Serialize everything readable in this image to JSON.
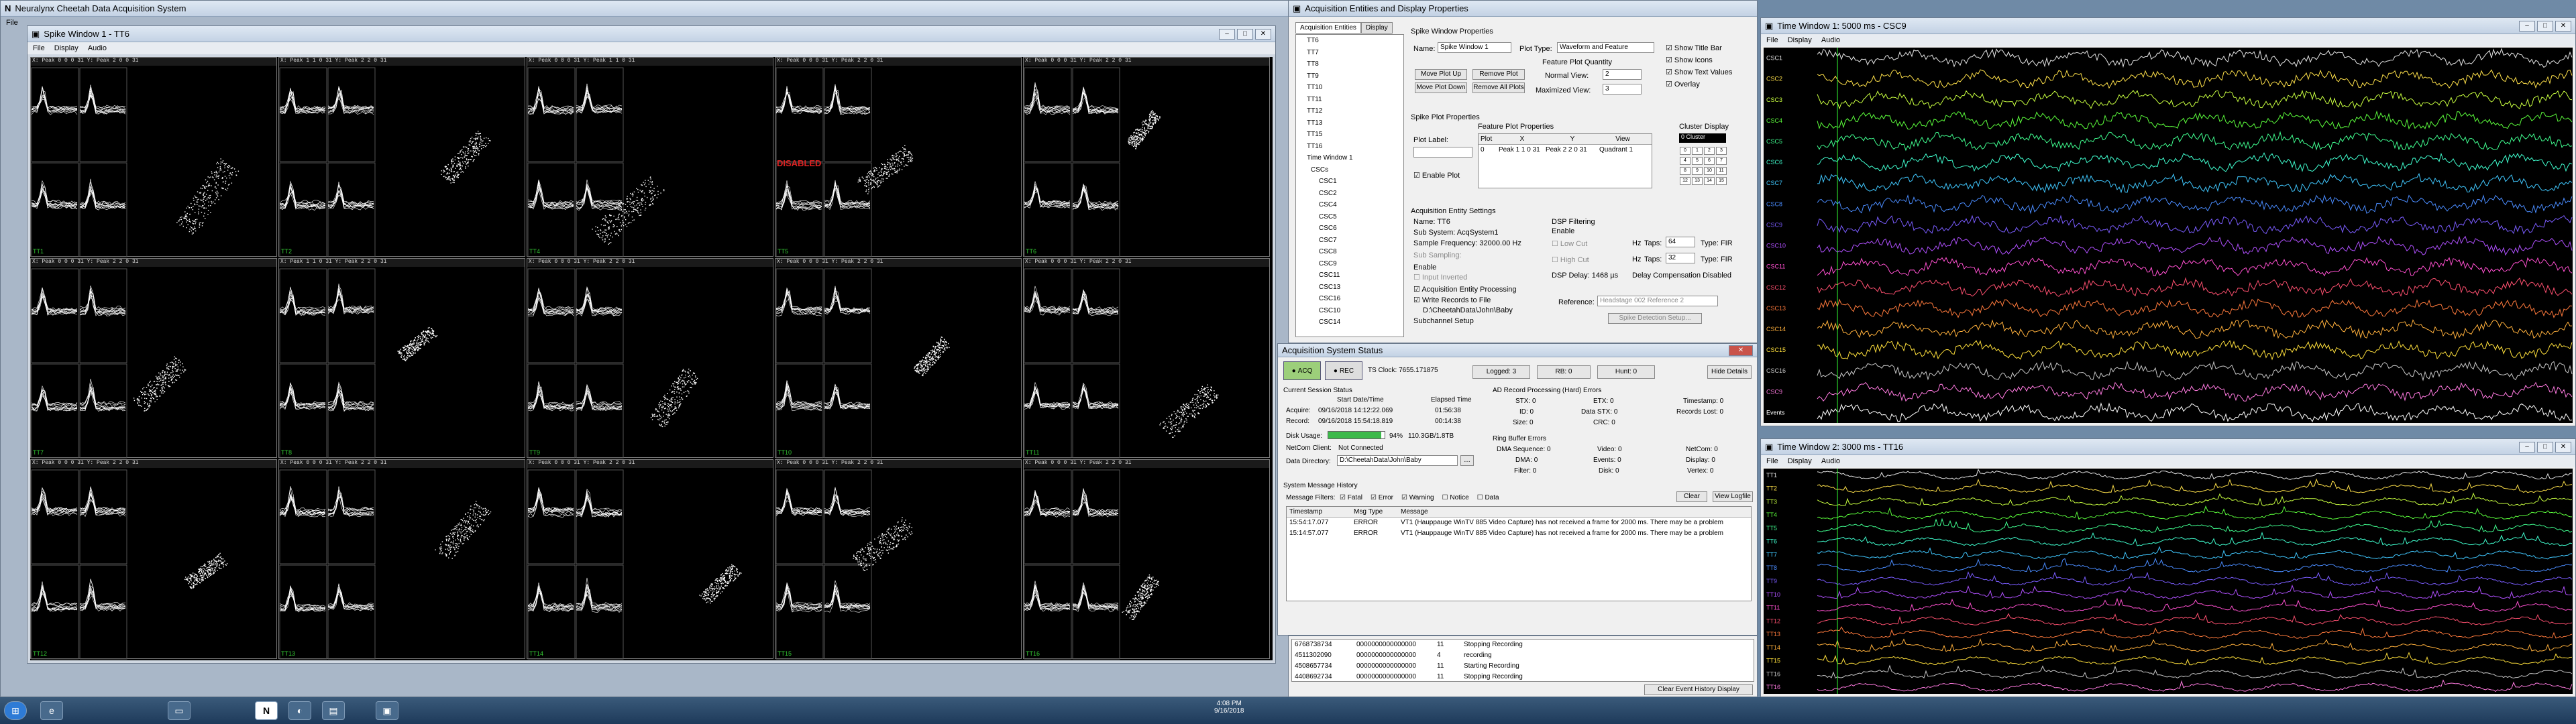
{
  "app_title": "Neuralynx Cheetah Data Acquisition System",
  "app_menu": [
    "File"
  ],
  "spike_window": {
    "title": "Spike Window 1 - TT6",
    "menu": [
      "File",
      "Display",
      "Audio"
    ],
    "cells": [
      {
        "name": "TT1",
        "peak_x": "X: Peak 0 0 0 31",
        "peak_y": "Y: Peak 2 0 0 31"
      },
      {
        "name": "TT2",
        "peak_x": "X: Peak 1 1 0 31",
        "peak_y": "Y: Peak 2 2 0 31"
      },
      {
        "name": "TT4",
        "peak_x": "X: Peak 0 0 0 31",
        "peak_y": "Y: Peak 1 1 0 31"
      },
      {
        "name": "TT5",
        "peak_x": "X: Peak 0 0 0 31",
        "peak_y": "Y: Peak 2 2 0 31"
      },
      {
        "name": "TT6",
        "peak_x": "X: Peak 0 0 0 31",
        "peak_y": "Y: Peak 2 2 0 31"
      },
      {
        "name": "TT7",
        "peak_x": "X: Peak 0 0 0 31",
        "peak_y": "Y: Peak 2 2 0 31"
      },
      {
        "name": "TT8",
        "peak_x": "X: Peak 1 1 0 31",
        "peak_y": "Y: Peak 2 2 0 31"
      },
      {
        "name": "TT9",
        "peak_x": "X: Peak 0 0 0 31",
        "peak_y": "Y: Peak 2 2 0 31"
      },
      {
        "name": "TT10",
        "peak_x": "X: Peak 0 0 0 31",
        "peak_y": "Y: Peak 2 2 0 31"
      },
      {
        "name": "TT11",
        "peak_x": "X: Peak 0 0 0 31",
        "peak_y": "Y: Peak 2 2 0 31"
      },
      {
        "name": "TT12",
        "peak_x": "X: Peak 0 0 0 31",
        "peak_y": "Y: Peak 2 2 0 31"
      },
      {
        "name": "TT13",
        "peak_x": "X: Peak 0 0 0 31",
        "peak_y": "Y: Peak 2 2 0 31"
      },
      {
        "name": "TT14",
        "peak_x": "X: Peak 0 0 0 31",
        "peak_y": "Y: Peak 2 2 0 31"
      },
      {
        "name": "TT15",
        "peak_x": "X: Peak 0 0 0 31",
        "peak_y": "Y: Peak 2 2 0 31"
      },
      {
        "name": "TT16",
        "peak_x": "X: Peak 0 0 0 31",
        "peak_y": "Y: Peak 2 2 0 31"
      }
    ],
    "disabled_label": "DISABLED"
  },
  "props": {
    "title": "Acquisition Entities and Display Properties",
    "tabs": [
      "Acquisition Entities",
      "Display"
    ],
    "tree": [
      "TT6",
      "TT7",
      "TT8",
      "TT9",
      "TT10",
      "TT11",
      "TT12",
      "TT13",
      "TT15",
      "TT16",
      "Time Window 1",
      "CSCs",
      "CSC1",
      "CSC2",
      "CSC4",
      "CSC5",
      "CSC6",
      "CSC7",
      "CSC8",
      "CSC9",
      "CSC11",
      "CSC13",
      "CSC16",
      "CSC10",
      "CSC14"
    ],
    "section_spike": "Spike Window Properties",
    "name_label": "Name:",
    "name_value": "Spike Window 1",
    "plot_type_label": "Plot Type:",
    "plot_type_value": "Waveform and Feature",
    "feature_qty": "Feature Plot Quantity",
    "normal_view_label": "Normal View:",
    "normal_view_value": "2",
    "max_view_label": "Maximized View:",
    "max_view_value": "3",
    "btn_move_up": "Move Plot Up",
    "btn_remove": "Remove Plot",
    "btn_move_down": "Move Plot Down",
    "btn_remove_all": "Remove All Plots",
    "checks": [
      "Show Title Bar",
      "Show Icons",
      "Show Text Values",
      "Overlay"
    ],
    "section_plot": "Spike Plot Properties",
    "feature_props": "Feature Plot Properties",
    "plot_label": "Plot Label:",
    "enable_plot": "Enable Plot",
    "feature_cols": [
      "Plot",
      "X",
      "Y",
      "View"
    ],
    "feature_row": [
      "0",
      "Peak 1 1 0 31",
      "Peak 2 2 0 31",
      "Quadrant 1"
    ],
    "cluster_display": "Cluster Display",
    "cluster_value": "0 Cluster",
    "acq_settings": "Acquisition Entity Settings",
    "acq_name": "Name:  TT6",
    "sub_system": "Sub System:  AcqSystem1",
    "sample_freq": "Sample Frequency:  32000.00 Hz",
    "sub_sampling": "Sub Sampling:",
    "enable": "Enable",
    "input_inverted": "Input Inverted",
    "acq_processing": "Acquisition Entity Processing",
    "write_records": "Write Records to File",
    "data_path": "D:\\CheetahData\\John\\Baby",
    "subchannel": "Subchannel Setup",
    "dsp_filtering": "DSP Filtering",
    "low_cut": "Low Cut",
    "high_cut": "High Cut",
    "hz_label": "Hz",
    "taps_label": "Taps:",
    "taps_low": "64",
    "taps_high": "32",
    "type_fir": "Type: FIR",
    "dsp_delay": "DSP Delay:  1468 µs",
    "delay_comp": "Delay Compensation Disabled",
    "reference_label": "Reference:",
    "reference_value": "Headstage 002 Reference 2",
    "spike_detection": "Spike Detection Setup..."
  },
  "status": {
    "title": "Acquisition System Status",
    "acq": "ACQ",
    "rec": "REC",
    "ts_clock": "TS Clock:  7655.171875",
    "logged": "Logged: 3",
    "rb": "RB: 0",
    "hunt": "Hunt: 0",
    "hide_details": "Hide Details",
    "session_title": "Current Session Status",
    "start_dt": "Start Date/Time",
    "elapsed": "Elapsed Time",
    "acquire_label": "Acquire:",
    "acquire_dt": "09/16/2018 14:12:22.069",
    "acquire_el": "01:56:38",
    "record_label": "Record:",
    "record_dt": "09/16/2018 15:54:18.819",
    "record_el": "00:14:38",
    "disk_label": "Disk Usage:",
    "disk_pct": "94%",
    "disk_pct_value": 0.94,
    "disk_size": "110.3GB/1.8TB",
    "netcom_label": "NetCom Client:",
    "netcom_value": "Not Connected",
    "datadir_label": "Data Directory:",
    "datadir_value": "D:\\CheetahData\\John\\Baby",
    "ad_errors": "AD Record Processing (Hard) Errors",
    "stx": "STX:  0",
    "etx": "ETX:  0",
    "timestamp": "Timestamp:  0",
    "id": "ID:  0",
    "data_stx": "Data STX:  0",
    "records_lost": "Records Lost:  0",
    "size": "Size:  0",
    "crc": "CRC:  0",
    "ring_errors": "Ring Buffer Errors",
    "dma_seq": "DMA Sequence:  0",
    "video": "Video:  0",
    "netcom": "NetCom:  0",
    "dma": "DMA:  0",
    "events": "Events:  0",
    "display": "Display:  0",
    "filter": "Filter:  0",
    "disk": "Disk:  0",
    "vertex": "Vertex:  0",
    "history_title": "System Message History",
    "filters_label": "Message Filters:",
    "filters": [
      "Fatal",
      "Error",
      "Warning",
      "Notice",
      "Data"
    ],
    "clear": "Clear",
    "view_logfile": "View Logfile",
    "msg_cols": [
      "Timestamp",
      "Msg Type",
      "Message"
    ],
    "messages": [
      [
        "15:54:17.077",
        "ERROR",
        "VT1 (Hauppauge WinTV 885 Video Capture) has not received a frame for 2000 ms. There may be a problem"
      ],
      [
        "15:14:57.077",
        "ERROR",
        "VT1 (Hauppauge WinTV 885 Video Capture) has not received a frame for 2000 ms. There may be a problem"
      ]
    ]
  },
  "events": {
    "rows": [
      [
        "6768738734",
        "0000000000000000",
        "11",
        "Stopping Recording"
      ],
      [
        "4511302090",
        "0000000000000000",
        "4",
        "recording"
      ],
      [
        "4508657734",
        "0000000000000000",
        "11",
        "Starting Recording"
      ],
      [
        "4408692734",
        "0000000000000000",
        "11",
        "Stopping Recording"
      ]
    ],
    "clear_btn": "Clear Event History Display"
  },
  "time1": {
    "title": "Time Window 1: 5000 ms - CSC9",
    "menu": [
      "File",
      "Display",
      "Audio"
    ],
    "channels": [
      "CSC1",
      "CSC2",
      "CSC3",
      "CSC4",
      "CSC5",
      "CSC6",
      "CSC7",
      "CSC8",
      "CSC9",
      "CSC10",
      "CSC11",
      "CSC12",
      "CSC13",
      "CSC14",
      "CSC15",
      "CSC16",
      "CSC9",
      "Events"
    ]
  },
  "time2": {
    "title": "Time Window 2: 3000 ms - TT16",
    "menu": [
      "File",
      "Display",
      "Audio"
    ],
    "channels": [
      "TT1",
      "TT2",
      "TT3",
      "TT4",
      "TT5",
      "TT6",
      "TT7",
      "TT8",
      "TT9",
      "TT10",
      "TT11",
      "TT12",
      "TT13",
      "TT14",
      "TT15",
      "TT16",
      "TT16"
    ]
  },
  "taskbar": {
    "time": "4:08 PM",
    "date": "9/16/2018"
  },
  "colors": {
    "csc_palette": [
      "#e6e6e6",
      "#ffe14a",
      "#c8ff40",
      "#5cff3c",
      "#40ff90",
      "#40ffd0",
      "#40c8ff",
      "#4a8cff",
      "#7a5cff",
      "#b050ff",
      "#ff50d0",
      "#ff5070",
      "#ff7a3c",
      "#ffb03c",
      "#ffe03c",
      "#c8c8c8",
      "#ff7ae0",
      "#ffffff"
    ]
  }
}
